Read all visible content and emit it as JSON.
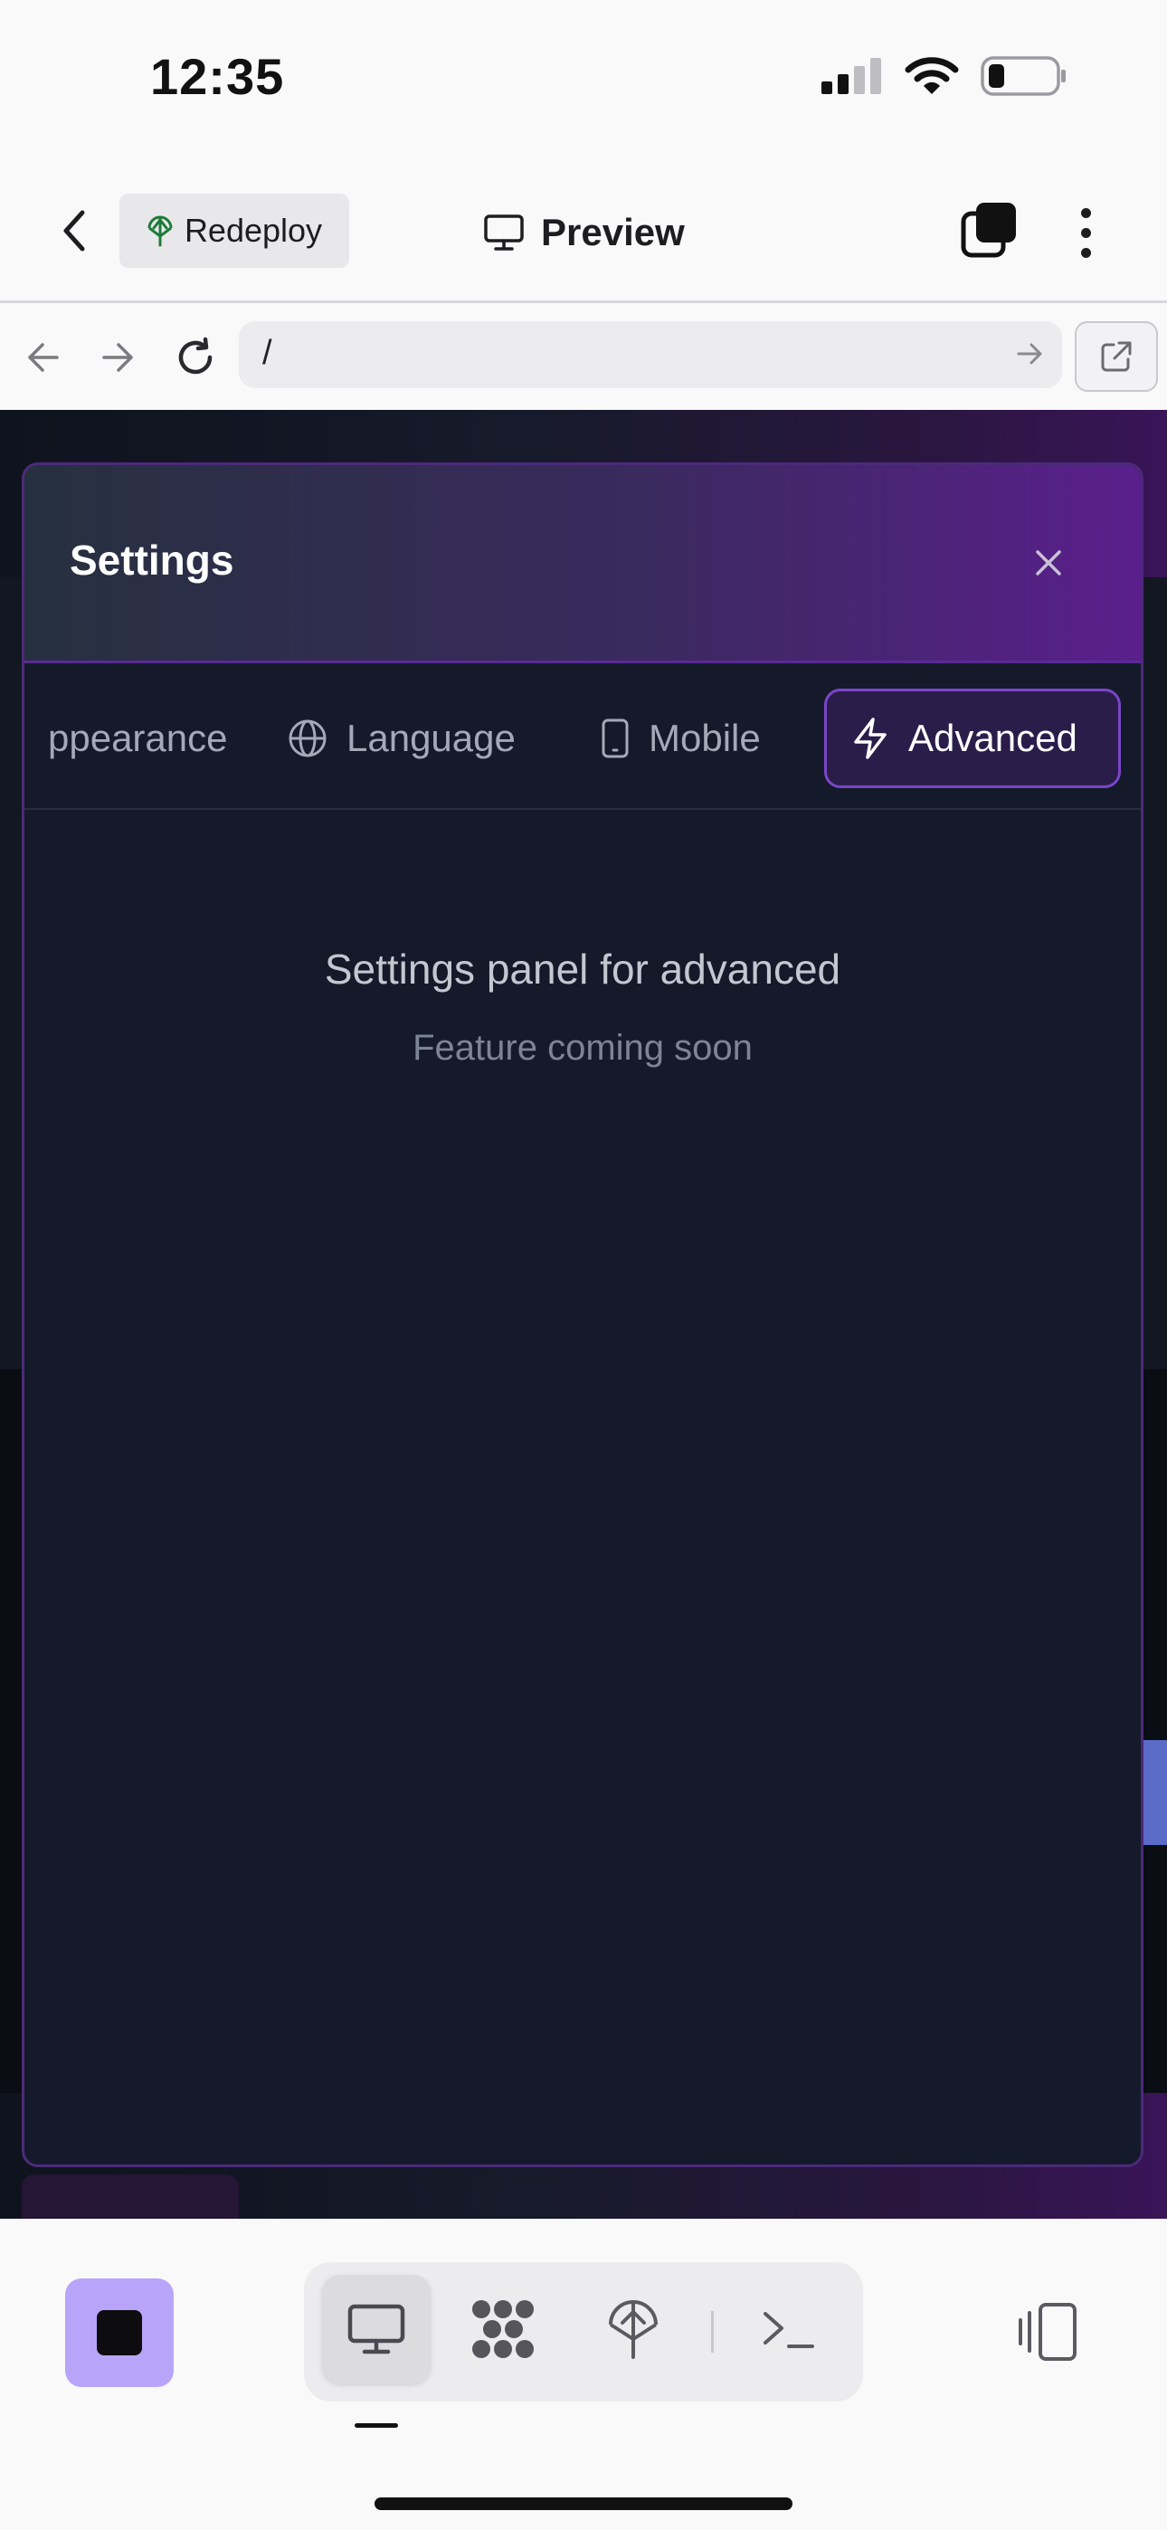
{
  "status_bar": {
    "time": "12:35"
  },
  "header": {
    "redeploy_label": "Redeploy",
    "title": "Preview"
  },
  "url_bar": {
    "value": "/"
  },
  "modal": {
    "title": "Settings",
    "tabs": [
      {
        "label": "ppearance",
        "icon": "palette-icon",
        "active": false
      },
      {
        "label": "Language",
        "icon": "globe-icon",
        "active": false
      },
      {
        "label": "Mobile",
        "icon": "smartphone-icon",
        "active": false
      },
      {
        "label": "Advanced",
        "icon": "lightning-icon",
        "active": true
      }
    ],
    "panel_title": "Settings panel for advanced",
    "panel_subtitle": "Feature coming soon"
  },
  "toolbar": {
    "items": [
      "desktop-icon",
      "apps-icon",
      "deploy-icon",
      "terminal-icon"
    ],
    "active_item": "desktop-icon"
  },
  "colors": {
    "accent": "#7b45c8",
    "stop_button": "#b8a4f8",
    "modal_bg": "#141a2a"
  }
}
